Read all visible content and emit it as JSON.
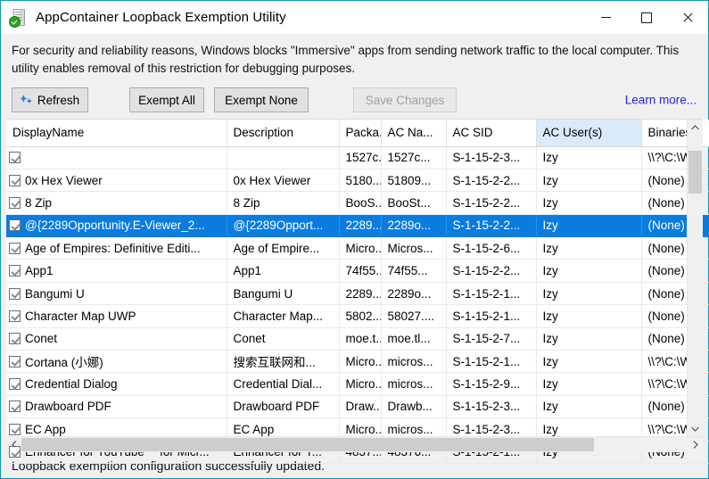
{
  "window": {
    "title": "AppContainer Loopback Exemption Utility",
    "app_icon": "server-shield-check-icon",
    "controls": {
      "minimize": "minimize-icon",
      "maximize": "maximize-icon",
      "close": "close-icon"
    }
  },
  "description": "For security and reliability reasons, Windows blocks \"Immersive\" apps from sending network traffic to the local computer. This utility enables removal of this restriction for debugging purposes.",
  "toolbar": {
    "refresh_label": "Refresh",
    "refresh_icon": "refresh-icon",
    "exempt_all_label": "Exempt All",
    "exempt_none_label": "Exempt None",
    "save_changes_label": "Save Changes",
    "save_changes_disabled": true,
    "learn_more_label": "Learn more...",
    "link_color": "#2b22e8"
  },
  "grid": {
    "sorted_column": "AC User(s)",
    "selected_row_index": 3,
    "selection_color": "#0a7ce0",
    "header_highlight_color": "#d9ebf9",
    "columns": [
      {
        "key": "display_name",
        "label": "DisplayName"
      },
      {
        "key": "description",
        "label": "Description"
      },
      {
        "key": "package",
        "label": "Packa..."
      },
      {
        "key": "ac_name",
        "label": "AC Na..."
      },
      {
        "key": "ac_sid",
        "label": "AC SID"
      },
      {
        "key": "ac_users",
        "label": "AC User(s)"
      },
      {
        "key": "binaries",
        "label": "Binaries"
      }
    ],
    "rows": [
      {
        "checked": true,
        "display_name": "",
        "description": "",
        "package": "1527c...",
        "ac_name": "1527c...",
        "ac_sid": "S-1-15-2-3...",
        "ac_users": "Izy",
        "binaries": "\\\\?\\C:\\W"
      },
      {
        "checked": true,
        "display_name": "0x Hex Viewer",
        "description": "0x Hex Viewer",
        "package": "5180...",
        "ac_name": "51809...",
        "ac_sid": "S-1-15-2-2...",
        "ac_users": "Izy",
        "binaries": "(None)"
      },
      {
        "checked": true,
        "display_name": "8 Zip",
        "description": "8 Zip",
        "package": "BooS...",
        "ac_name": "BooSt...",
        "ac_sid": "S-1-15-2-2...",
        "ac_users": "Izy",
        "binaries": "(None)"
      },
      {
        "checked": true,
        "display_name": "@{2289Opportunity.E-Viewer_2...",
        "description": "@{2289Opport...",
        "package": "2289...",
        "ac_name": "2289o...",
        "ac_sid": "S-1-15-2-2...",
        "ac_users": "Izy",
        "binaries": "(None)"
      },
      {
        "checked": true,
        "display_name": "Age of Empires: Definitive Editi...",
        "description": "Age of Empire...",
        "package": "Micro...",
        "ac_name": "Micros...",
        "ac_sid": "S-1-15-2-6...",
        "ac_users": "Izy",
        "binaries": "(None)"
      },
      {
        "checked": true,
        "display_name": "App1",
        "description": "App1",
        "package": "74f55...",
        "ac_name": "74f55...",
        "ac_sid": "S-1-15-2-2...",
        "ac_users": "Izy",
        "binaries": "(None)"
      },
      {
        "checked": true,
        "display_name": "Bangumi U",
        "description": "Bangumi U",
        "package": "2289...",
        "ac_name": "2289o...",
        "ac_sid": "S-1-15-2-1...",
        "ac_users": "Izy",
        "binaries": "(None)"
      },
      {
        "checked": true,
        "display_name": "Character Map UWP",
        "description": "Character Map...",
        "package": "5802...",
        "ac_name": "58027....",
        "ac_sid": "S-1-15-2-1...",
        "ac_users": "Izy",
        "binaries": "(None)"
      },
      {
        "checked": true,
        "display_name": "Conet",
        "description": "Conet",
        "package": "moe.t...",
        "ac_name": "moe.tl...",
        "ac_sid": "S-1-15-2-7...",
        "ac_users": "Izy",
        "binaries": "(None)"
      },
      {
        "checked": true,
        "display_name": "Cortana (小娜)",
        "description": "搜索互联网和...",
        "package": "Micro...",
        "ac_name": "micros...",
        "ac_sid": "S-1-15-2-1...",
        "ac_users": "Izy",
        "binaries": "\\\\?\\C:\\W"
      },
      {
        "checked": true,
        "display_name": "Credential Dialog",
        "description": "Credential Dial...",
        "package": "Micro...",
        "ac_name": "micros...",
        "ac_sid": "S-1-15-2-9...",
        "ac_users": "Izy",
        "binaries": "\\\\?\\C:\\W"
      },
      {
        "checked": true,
        "display_name": "Drawboard PDF",
        "description": "Drawboard PDF",
        "package": "Draw...",
        "ac_name": "Drawb...",
        "ac_sid": "S-1-15-2-3...",
        "ac_users": "Izy",
        "binaries": "(None)"
      },
      {
        "checked": true,
        "display_name": "EC App",
        "description": "EC App",
        "package": "Micro...",
        "ac_name": "micros...",
        "ac_sid": "S-1-15-2-3...",
        "ac_users": "Izy",
        "binaries": "\\\\?\\C:\\W"
      },
      {
        "checked": true,
        "display_name": "Enhancer for YouTube™ for Micr...",
        "description": "Enhancer for Y...",
        "package": "4837...",
        "ac_name": "48376...",
        "ac_sid": "S-1-15-2-1...",
        "ac_users": "Izy",
        "binaries": "(None)"
      }
    ]
  },
  "scrollbars": {
    "vertical_up": "chevron-up-icon",
    "vertical_down": "chevron-down-icon",
    "horizontal_left": "chevron-left-icon",
    "horizontal_right": "chevron-right-icon"
  },
  "statusbar": {
    "message": "Loopback exemption configuration successfully updated."
  }
}
